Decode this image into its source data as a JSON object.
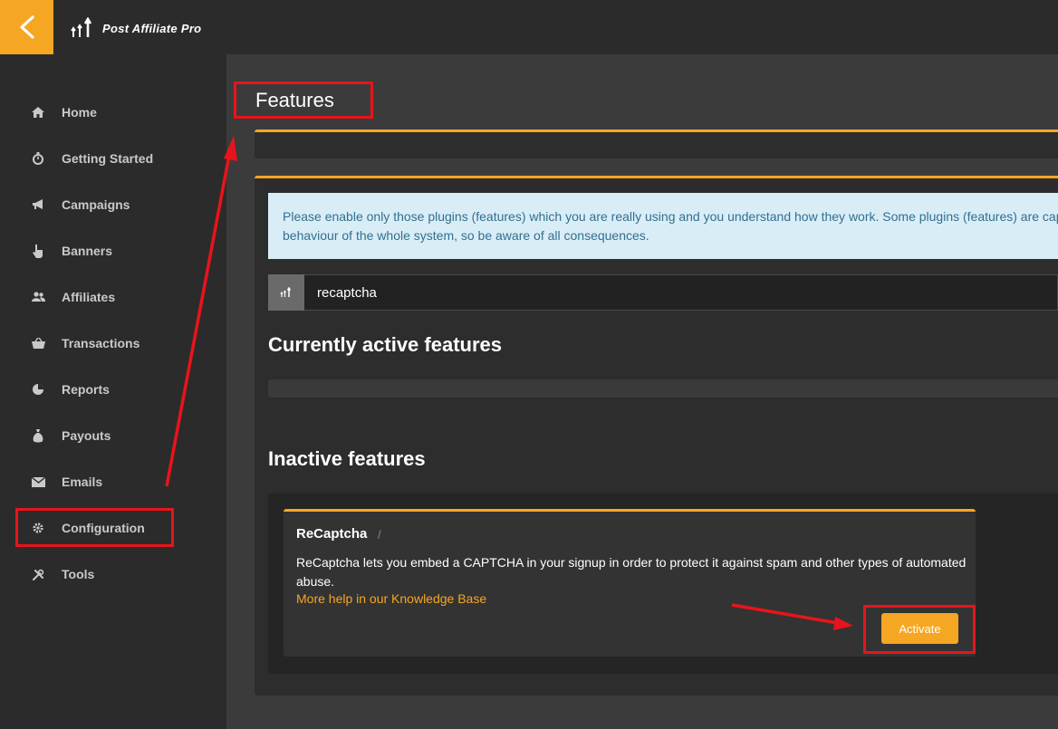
{
  "brand": {
    "name": "Post Affiliate Pro"
  },
  "sidebar": {
    "items": [
      {
        "label": "Home",
        "icon": "home-icon"
      },
      {
        "label": "Getting Started",
        "icon": "stopwatch-icon"
      },
      {
        "label": "Campaigns",
        "icon": "megaphone-icon"
      },
      {
        "label": "Banners",
        "icon": "pointer-hand-icon"
      },
      {
        "label": "Affiliates",
        "icon": "users-icon"
      },
      {
        "label": "Transactions",
        "icon": "basket-icon"
      },
      {
        "label": "Reports",
        "icon": "pie-chart-icon"
      },
      {
        "label": "Payouts",
        "icon": "money-bag-icon"
      },
      {
        "label": "Emails",
        "icon": "envelope-icon"
      },
      {
        "label": "Configuration",
        "icon": "gear-icon"
      },
      {
        "label": "Tools",
        "icon": "tools-icon"
      }
    ]
  },
  "page": {
    "title": "Features"
  },
  "info": {
    "text": "Please enable only those plugins (features) which you are really using and you understand how they work. Some plugins (features) are capable of changing behaviour of the whole system, so be aware of all consequences."
  },
  "search": {
    "value": "recaptcha"
  },
  "sections": {
    "active_title": "Currently active features",
    "inactive_title": "Inactive features"
  },
  "feature": {
    "name": "ReCaptcha",
    "separator": "/",
    "description": "ReCaptcha lets you embed a CAPTCHA in your signup in order to protect it against spam and other types of automated abuse.",
    "link_label": "More help in our Knowledge Base",
    "button_label": "Activate"
  },
  "colors": {
    "accent": "#f5a623",
    "highlight": "#e8141b",
    "info_bg": "#d9edf7",
    "info_text": "#31708f"
  }
}
